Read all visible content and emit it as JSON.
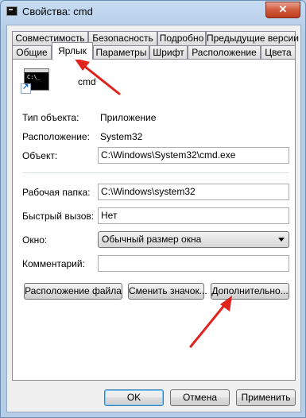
{
  "window": {
    "title": "Свойства: cmd",
    "close_glyph": "✕"
  },
  "tabs_row1": [
    "Совместимость",
    "Безопасность",
    "Подробно",
    "Предыдущие версии"
  ],
  "tabs_row2": [
    "Общие",
    "Ярлык",
    "Параметры",
    "Шрифт",
    "Расположение",
    "Цвета"
  ],
  "active_tab": "Ярлык",
  "shortcut": {
    "name": "cmd",
    "icon_prompt": "C:\\_",
    "target_type_label": "Тип объекта:",
    "target_type_value": "Приложение",
    "location_label": "Расположение:",
    "location_value": "System32",
    "target_label": "Объект:",
    "target_value": "C:\\Windows\\System32\\cmd.exe",
    "start_in_label": "Рабочая папка:",
    "start_in_value": "C:\\Windows\\system32",
    "hotkey_label": "Быстрый вызов:",
    "hotkey_value": "Нет",
    "run_label": "Окно:",
    "run_value": "Обычный размер окна",
    "comment_label": "Комментарий:",
    "comment_value": ""
  },
  "panel_buttons": {
    "open_location": "Расположение файла",
    "change_icon": "Сменить значок...",
    "advanced": "Дополнительно..."
  },
  "dialog_buttons": {
    "ok": "OK",
    "cancel": "Отмена",
    "apply": "Применить"
  },
  "colors": {
    "annotation_arrow": "#e0231c",
    "window_frame": "#b9d1ea"
  }
}
